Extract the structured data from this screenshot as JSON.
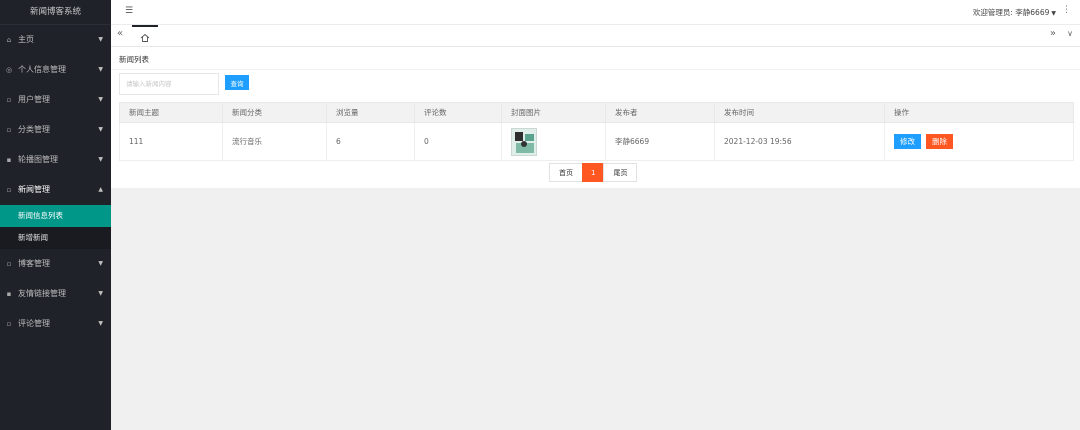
{
  "app": {
    "title": "新闻博客系统"
  },
  "header": {
    "user_label": "欢迎管理员: 李静6669",
    "more_icon": "vertical-dots-icon"
  },
  "tabs": {
    "home_icon": "home-icon"
  },
  "sidebar": {
    "items": [
      {
        "label": "主页",
        "icon": "home-icon"
      },
      {
        "label": "个人信息管理",
        "icon": "user-icon"
      },
      {
        "label": "用户管理",
        "icon": "users-icon"
      },
      {
        "label": "分类管理",
        "icon": "category-icon"
      },
      {
        "label": "轮播图管理",
        "icon": "image-icon"
      },
      {
        "label": "新闻管理",
        "icon": "news-icon",
        "open": true,
        "children": [
          {
            "label": "新闻信息列表",
            "active": true
          },
          {
            "label": "新增新闻"
          }
        ]
      },
      {
        "label": "博客管理",
        "icon": "blog-icon"
      },
      {
        "label": "友情链接管理",
        "icon": "link-icon"
      },
      {
        "label": "评论管理",
        "icon": "comment-icon"
      }
    ]
  },
  "content": {
    "title": "新闻列表",
    "search": {
      "placeholder": "请输入新闻内容",
      "button": "查询"
    },
    "table": {
      "columns": [
        "新闻主题",
        "新闻分类",
        "浏览量",
        "评论数",
        "封面图片",
        "发布者",
        "发布时间",
        "操作"
      ],
      "rows": [
        {
          "subject": "111",
          "category": "流行音乐",
          "views": "6",
          "comments": "0",
          "publisher": "李静6669",
          "time": "2021-12-03 19:56",
          "edit": "修改",
          "delete": "删除"
        }
      ]
    },
    "pager": {
      "first": "首页",
      "current": "1",
      "last": "尾页"
    }
  },
  "colors": {
    "sidebar": "#20222a",
    "active": "#009688",
    "primary": "#1e9fff",
    "danger": "#ff5722"
  }
}
